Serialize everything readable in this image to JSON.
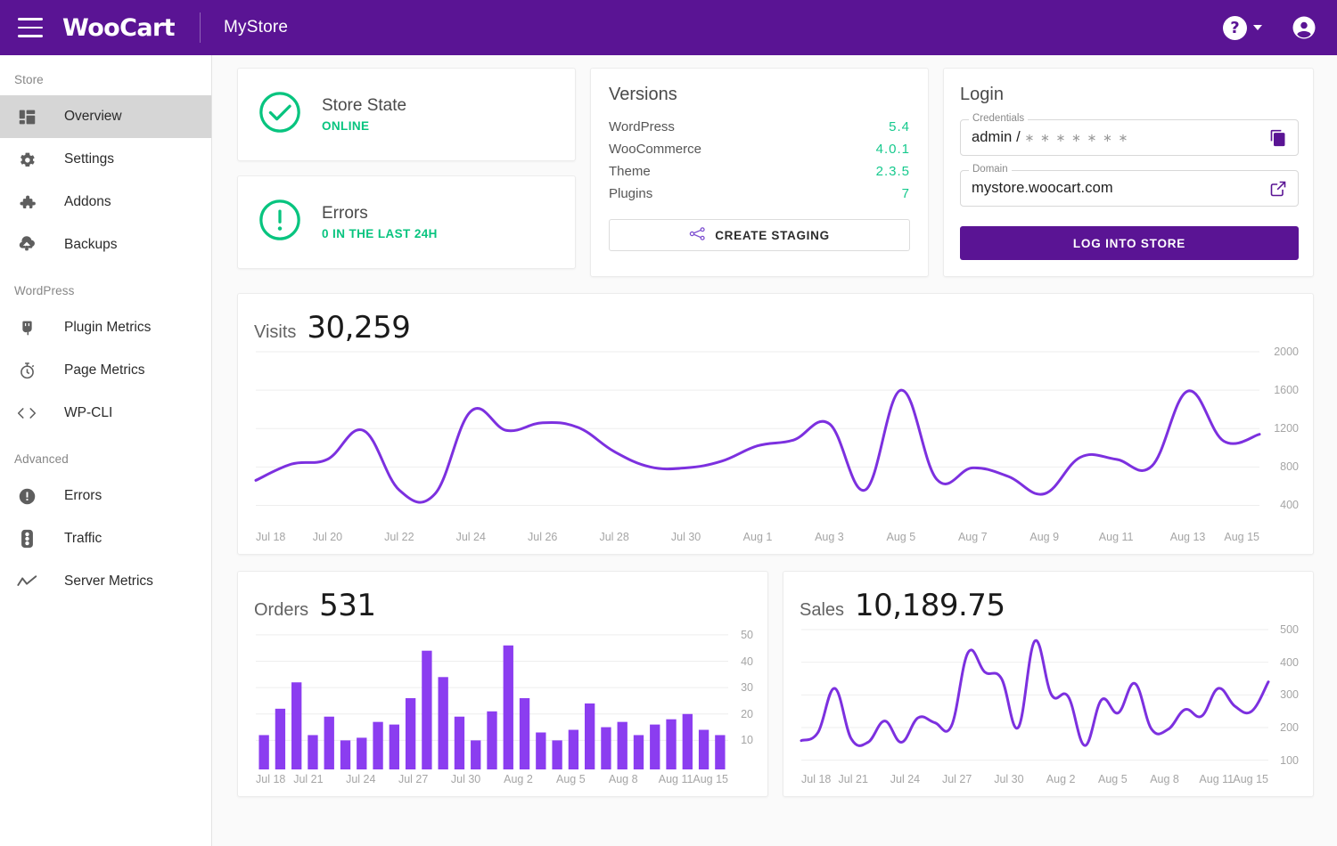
{
  "topbar": {
    "brand": "WooCart",
    "store_name": "MyStore",
    "menu_icon": "hamburger-icon",
    "help_glyph": "?",
    "accent": "#5a1494"
  },
  "sidebar": {
    "sections": [
      {
        "label": "Store",
        "items": [
          {
            "label": "Overview",
            "icon": "dashboard-icon",
            "active": true
          },
          {
            "label": "Settings",
            "icon": "gear-icon",
            "active": false
          },
          {
            "label": "Addons",
            "icon": "puzzle-icon",
            "active": false
          },
          {
            "label": "Backups",
            "icon": "cloud-upload-icon",
            "active": false
          }
        ]
      },
      {
        "label": "WordPress",
        "items": [
          {
            "label": "Plugin Metrics",
            "icon": "plug-icon",
            "active": false
          },
          {
            "label": "Page Metrics",
            "icon": "stopwatch-icon",
            "active": false
          },
          {
            "label": "WP-CLI",
            "icon": "code-icon",
            "active": false
          }
        ]
      },
      {
        "label": "Advanced",
        "items": [
          {
            "label": "Errors",
            "icon": "alert-circle-icon",
            "active": false
          },
          {
            "label": "Traffic",
            "icon": "traffic-light-icon",
            "active": false
          },
          {
            "label": "Server Metrics",
            "icon": "line-chart-icon",
            "active": false
          }
        ]
      }
    ]
  },
  "status": {
    "store_state": {
      "title": "Store State",
      "value": "ONLINE",
      "icon": "check-circle-icon",
      "color": "#08c47f"
    },
    "errors": {
      "title": "Errors",
      "value": "0 IN THE LAST 24H",
      "icon": "alert-circle-icon",
      "color": "#08c47f"
    }
  },
  "versions": {
    "title": "Versions",
    "rows": [
      {
        "name": "WordPress",
        "value": "5.4"
      },
      {
        "name": "WooCommerce",
        "value": "4.0.1"
      },
      {
        "name": "Theme",
        "value": "2.3.5"
      },
      {
        "name": "Plugins",
        "value": "7"
      }
    ],
    "create_staging_label": "CREATE STAGING",
    "create_staging_icon": "share-branch-icon",
    "value_color": "#16c98d"
  },
  "login": {
    "title": "Login",
    "credentials_legend": "Credentials",
    "credentials_user": "admin / ",
    "credentials_password_mask": "∗ ∗ ∗ ∗ ∗ ∗ ∗",
    "copy_icon": "copy-icon",
    "domain_legend": "Domain",
    "domain_value": "mystore.woocart.com",
    "open_icon": "external-link-icon",
    "login_button_label": "LOG INTO STORE"
  },
  "chart_data": [
    {
      "id": "visits",
      "type": "line",
      "title": "Visits",
      "total": "30,259",
      "xlabel": "",
      "ylabel": "",
      "ylim": [
        200,
        2000
      ],
      "yticks": [
        400,
        800,
        1200,
        1600,
        2000
      ],
      "grid": true,
      "line_color": "#7c30df",
      "tick_labels": [
        "Jul 18",
        "Jul 20",
        "Jul 22",
        "Jul 24",
        "Jul 26",
        "Jul 28",
        "Jul 30",
        "Aug 1",
        "Aug 3",
        "Aug 5",
        "Aug 7",
        "Aug 9",
        "Aug 11",
        "Aug 13",
        "Aug 15"
      ],
      "x": [
        "Jul 18",
        "Jul 19",
        "Jul 20",
        "Jul 21",
        "Jul 22",
        "Jul 23",
        "Jul 24",
        "Jul 25",
        "Jul 26",
        "Jul 27",
        "Jul 28",
        "Jul 29",
        "Jul 30",
        "Jul 31",
        "Aug 1",
        "Aug 2",
        "Aug 3",
        "Aug 4",
        "Aug 5",
        "Aug 6",
        "Aug 7",
        "Aug 8",
        "Aug 9",
        "Aug 10",
        "Aug 11",
        "Aug 12",
        "Aug 13",
        "Aug 14",
        "Aug 15"
      ],
      "values": [
        660,
        830,
        880,
        1180,
        560,
        520,
        1380,
        1180,
        1260,
        1210,
        960,
        800,
        790,
        860,
        1020,
        1080,
        1250,
        560,
        1600,
        670,
        790,
        700,
        520,
        900,
        880,
        810,
        1590,
        1070,
        1140
      ]
    },
    {
      "id": "orders",
      "type": "bar",
      "title": "Orders",
      "total": "531",
      "xlabel": "",
      "ylabel": "",
      "ylim": [
        0,
        52
      ],
      "yticks": [
        10,
        20,
        30,
        40,
        50
      ],
      "grid": true,
      "bar_color": "#8b3df0",
      "tick_labels": [
        "Jul 18",
        "Jul 21",
        "Jul 24",
        "Jul 27",
        "Jul 30",
        "Aug 2",
        "Aug 5",
        "Aug 8",
        "Aug 11",
        "Aug 15"
      ],
      "categories": [
        "Jul 18",
        "Jul 19",
        "Jul 20",
        "Jul 21",
        "Jul 22",
        "Jul 23",
        "Jul 24",
        "Jul 25",
        "Jul 26",
        "Jul 27",
        "Jul 28",
        "Jul 29",
        "Jul 30",
        "Jul 31",
        "Aug 1",
        "Aug 2",
        "Aug 3",
        "Aug 4",
        "Aug 5",
        "Aug 6",
        "Aug 7",
        "Aug 8",
        "Aug 9",
        "Aug 10",
        "Aug 11",
        "Aug 12",
        "Aug 13",
        "Aug 14",
        "Aug 15"
      ],
      "values": [
        12,
        22,
        32,
        12,
        19,
        10,
        11,
        17,
        16,
        26,
        44,
        34,
        19,
        10,
        21,
        46,
        26,
        13,
        10,
        14,
        24,
        15,
        17,
        12,
        16,
        18,
        20,
        14,
        12
      ]
    },
    {
      "id": "sales",
      "type": "line",
      "title": "Sales",
      "total": "10,189.75",
      "xlabel": "",
      "ylabel": "",
      "ylim": [
        80,
        500
      ],
      "yticks": [
        100,
        200,
        300,
        400,
        500
      ],
      "grid": true,
      "line_color": "#7c30df",
      "tick_labels": [
        "Jul 18",
        "Jul 21",
        "Jul 24",
        "Jul 27",
        "Jul 30",
        "Aug 2",
        "Aug 5",
        "Aug 8",
        "Aug 11",
        "Aug 15"
      ],
      "x": [
        "Jul 18",
        "Jul 19",
        "Jul 20",
        "Jul 21",
        "Jul 22",
        "Jul 23",
        "Jul 24",
        "Jul 25",
        "Jul 26",
        "Jul 27",
        "Jul 28",
        "Jul 29",
        "Jul 30",
        "Jul 31",
        "Aug 1",
        "Aug 2",
        "Aug 3",
        "Aug 4",
        "Aug 5",
        "Aug 6",
        "Aug 7",
        "Aug 8",
        "Aug 9",
        "Aug 10",
        "Aug 11",
        "Aug 12",
        "Aug 13",
        "Aug 14",
        "Aug 15"
      ],
      "values": [
        160,
        185,
        320,
        165,
        155,
        220,
        155,
        230,
        215,
        205,
        430,
        370,
        350,
        200,
        465,
        300,
        295,
        145,
        285,
        245,
        335,
        195,
        195,
        255,
        235,
        320,
        265,
        250,
        340
      ]
    }
  ]
}
